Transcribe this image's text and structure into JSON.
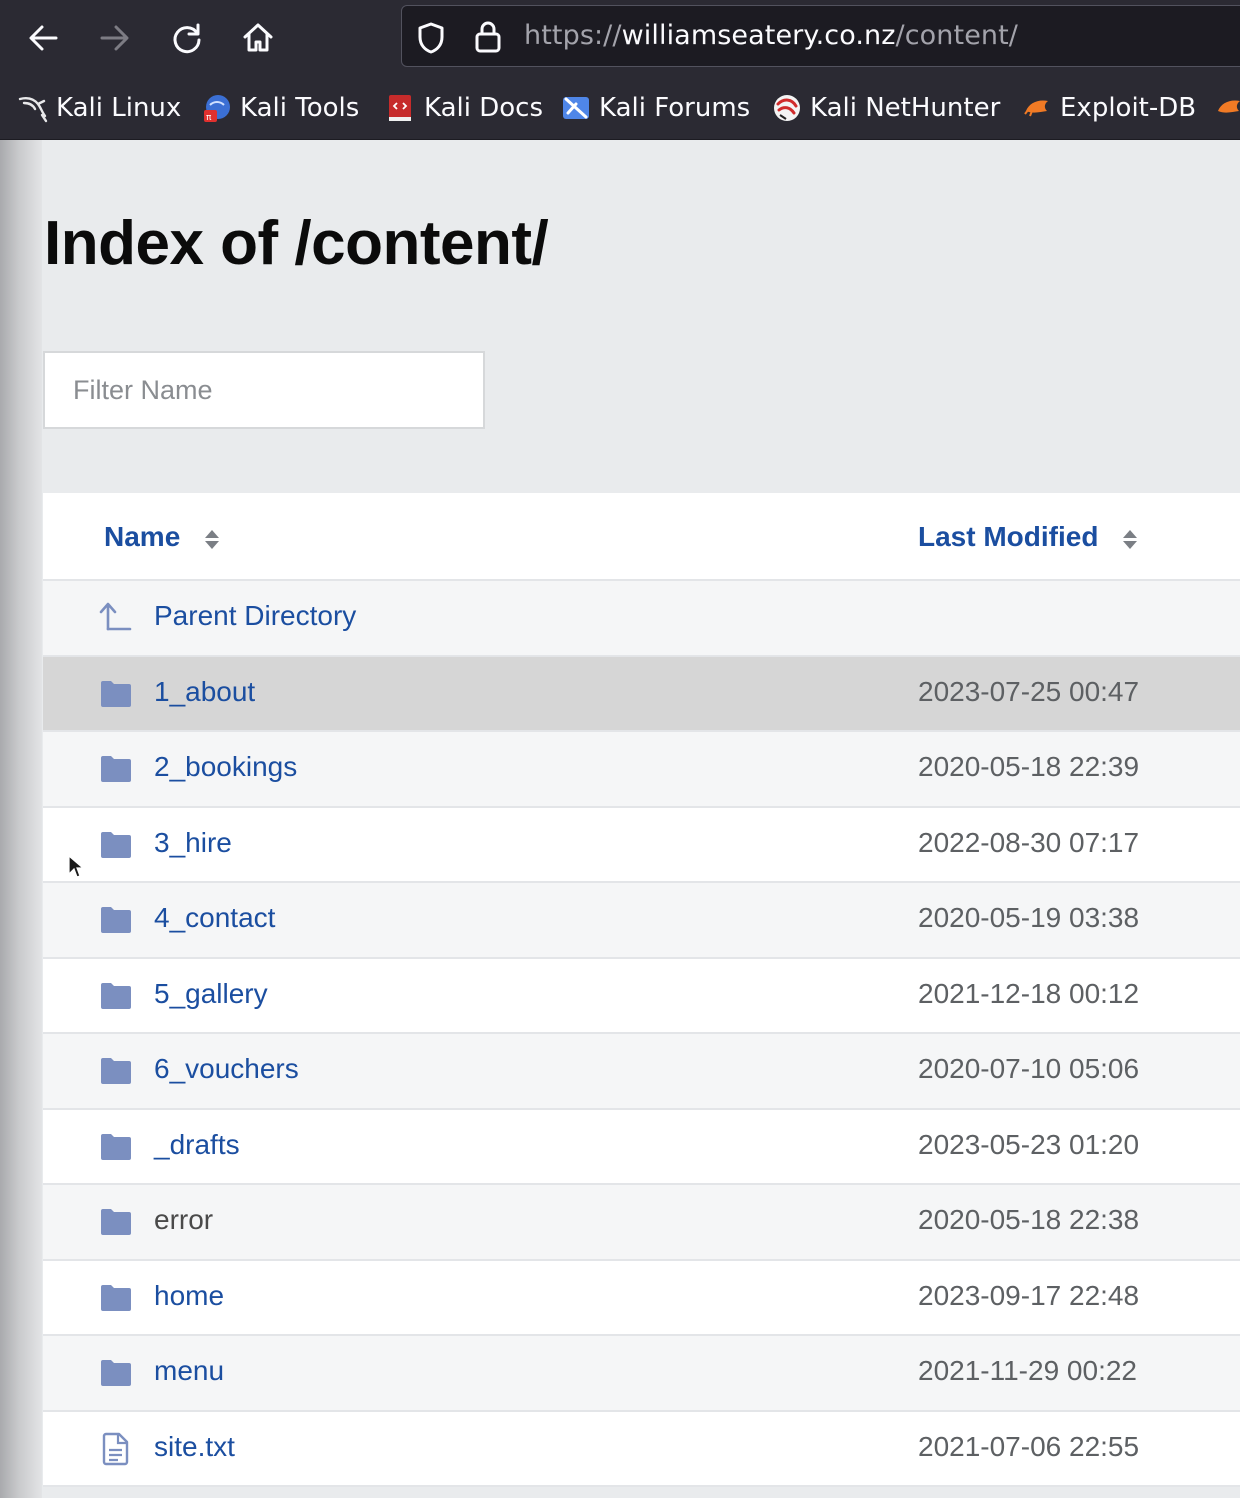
{
  "browser": {
    "url_scheme": "https://",
    "url_host": "williamseatery.co.nz",
    "url_path": "/content/",
    "bookmarks": [
      {
        "label": "Kali Linux",
        "icon": "kali-dragon-icon"
      },
      {
        "label": "Kali Tools",
        "icon": "kali-tools-icon"
      },
      {
        "label": "Kali Docs",
        "icon": "kali-docs-icon"
      },
      {
        "label": "Kali Forums",
        "icon": "kali-forums-icon"
      },
      {
        "label": "Kali NetHunter",
        "icon": "kali-nethunter-icon"
      },
      {
        "label": "Exploit-DB",
        "icon": "exploit-db-icon"
      }
    ]
  },
  "page": {
    "title": "Index of /content/",
    "filter_placeholder": "Filter Name",
    "columns": {
      "name": "Name",
      "last_modified": "Last Modified"
    },
    "parent": {
      "label": "Parent Directory",
      "icon": "parent-directory-icon"
    },
    "entries": [
      {
        "name": "1_about",
        "type": "folder",
        "modified": "2023-07-25 00:47"
      },
      {
        "name": "2_bookings",
        "type": "folder",
        "modified": "2020-05-18 22:39"
      },
      {
        "name": "3_hire",
        "type": "folder",
        "modified": "2022-08-30 07:17"
      },
      {
        "name": "4_contact",
        "type": "folder",
        "modified": "2020-05-19 03:38"
      },
      {
        "name": "5_gallery",
        "type": "folder",
        "modified": "2021-12-18 00:12"
      },
      {
        "name": "6_vouchers",
        "type": "folder",
        "modified": "2020-07-10 05:06"
      },
      {
        "name": "_drafts",
        "type": "folder",
        "modified": "2023-05-23 01:20"
      },
      {
        "name": "error",
        "type": "folder",
        "modified": "2020-05-18 22:38"
      },
      {
        "name": "home",
        "type": "folder",
        "modified": "2023-09-17 22:48"
      },
      {
        "name": "menu",
        "type": "folder",
        "modified": "2021-11-29 00:22"
      },
      {
        "name": "site.txt",
        "type": "file",
        "modified": "2021-07-06 22:55"
      }
    ]
  },
  "colors": {
    "link": "#1b4ea0",
    "folder_icon": "#7b8fc0",
    "hover_row": "#d6d6d6"
  }
}
